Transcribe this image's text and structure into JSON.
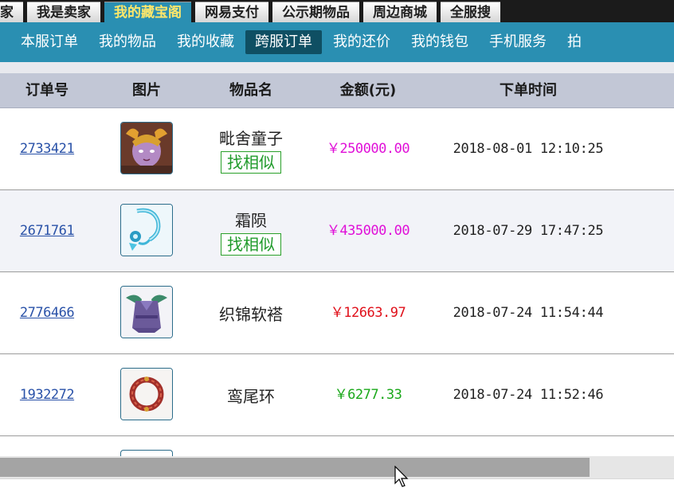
{
  "top_tabs": [
    {
      "label": "家",
      "active": false
    },
    {
      "label": "我是卖家",
      "active": false
    },
    {
      "label": "我的藏宝阁",
      "active": true
    },
    {
      "label": "网易支付",
      "active": false
    },
    {
      "label": "公示期物品",
      "active": false
    },
    {
      "label": "周边商城",
      "active": false
    },
    {
      "label": "全服搜",
      "active": false
    }
  ],
  "subnav": [
    {
      "label": "本服订单",
      "active": false
    },
    {
      "label": "我的物品",
      "active": false
    },
    {
      "label": "我的收藏",
      "active": false
    },
    {
      "label": "跨服订单",
      "active": true
    },
    {
      "label": "我的还价",
      "active": false
    },
    {
      "label": "我的钱包",
      "active": false
    },
    {
      "label": "手机服务",
      "active": false
    },
    {
      "label": "拍",
      "active": false
    }
  ],
  "table": {
    "headers": {
      "order_no": "订单号",
      "image": "图片",
      "item_name": "物品名",
      "amount": "金额(元)",
      "order_time": "下单时间"
    },
    "rows": [
      {
        "order_no": "2733421",
        "thumb_icon": "character-avatar-icon",
        "item_name": "毗舍童子",
        "find_similar": "找相似",
        "price": "￥250000.00",
        "price_color": "#e010d8",
        "time": "2018-08-01 12:10:25"
      },
      {
        "order_no": "2671761",
        "thumb_icon": "ice-chain-weapon-icon",
        "item_name": "霜陨",
        "find_similar": "找相似",
        "price": "￥435000.00",
        "price_color": "#e010d8",
        "time": "2018-07-29 17:47:25"
      },
      {
        "order_no": "2776466",
        "thumb_icon": "armor-robe-icon",
        "item_name": "织锦软褡",
        "find_similar": "",
        "price": "￥12663.97",
        "price_color": "#e0101a",
        "time": "2018-07-24 11:54:44"
      },
      {
        "order_no": "1932272",
        "thumb_icon": "red-ring-icon",
        "item_name": "鸾尾环",
        "find_similar": "",
        "price": "￥6277.33",
        "price_color": "#1aa81a",
        "time": "2018-07-24 11:52:46"
      }
    ]
  }
}
